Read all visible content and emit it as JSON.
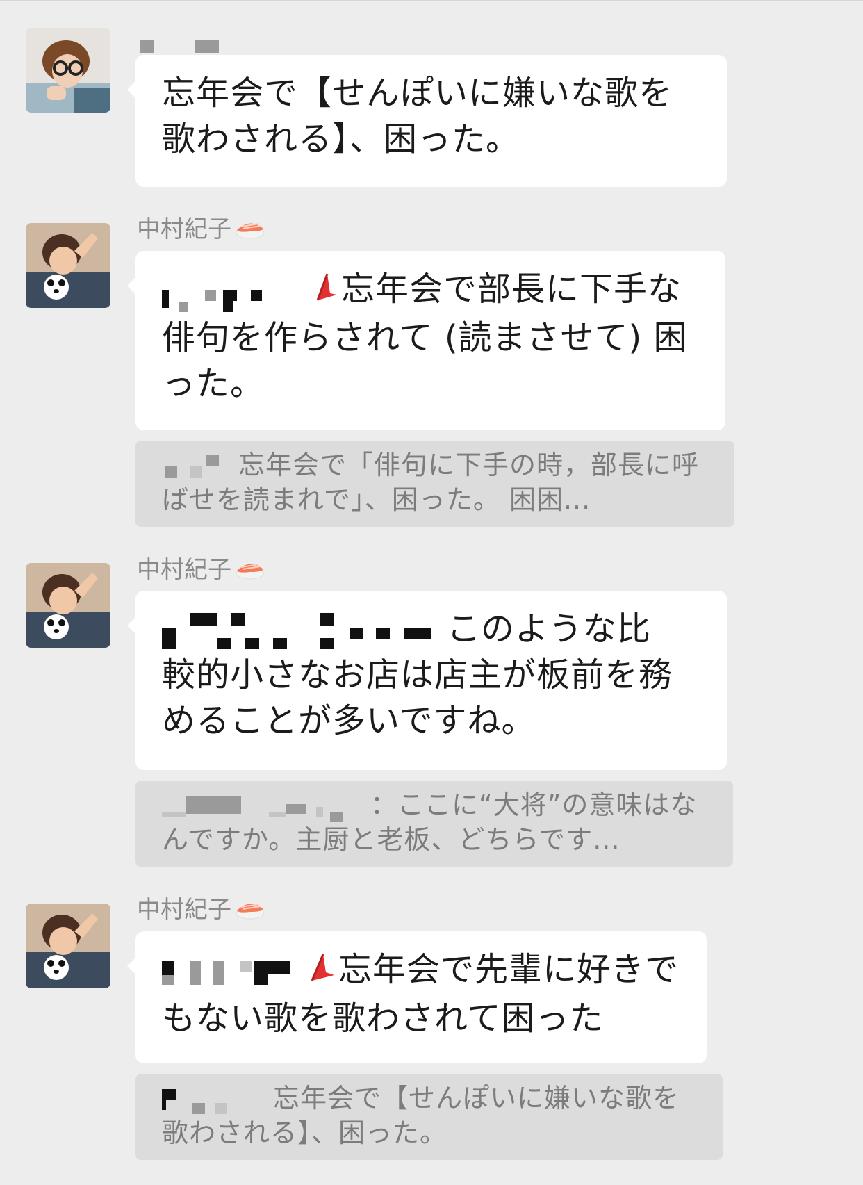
{
  "messages": [
    {
      "sender": "",
      "text": "忘年会で【せんぽいに嫌いな歌を歌わされる】、困った。"
    },
    {
      "sender": "中村紀子",
      "text": "忘年会で部長に下手な俳句を作らされて (読まさせて) 困った。",
      "quote": "忘年会で「俳句に下手の時，部長に呼ばせを読まれで」、困った。 困困..."
    },
    {
      "sender": "中村紀子",
      "text_line1": "このような比",
      "text_rest": "較的小さなお店は店主が板前を務めることが多いですね。",
      "quote_colon": "：",
      "quote_text": "ここに“大将”の意味はなんですか。主厨と老板、どちらです..."
    },
    {
      "sender": "中村紀子",
      "text": "忘年会で先輩に好きでもない歌を歌わされて困った",
      "quote": "忘年会で【せんぽいに嫌いな歌を歌わされる】、困った。"
    }
  ],
  "icons": {
    "sender_badge": "sushi-emoji-icon",
    "reply_flag": "red-flag-icon"
  },
  "colors": {
    "background": "#ededed",
    "bubble": "#ffffff",
    "quote_bg": "#dcdcdc",
    "sender_text": "#8a8a8a"
  }
}
